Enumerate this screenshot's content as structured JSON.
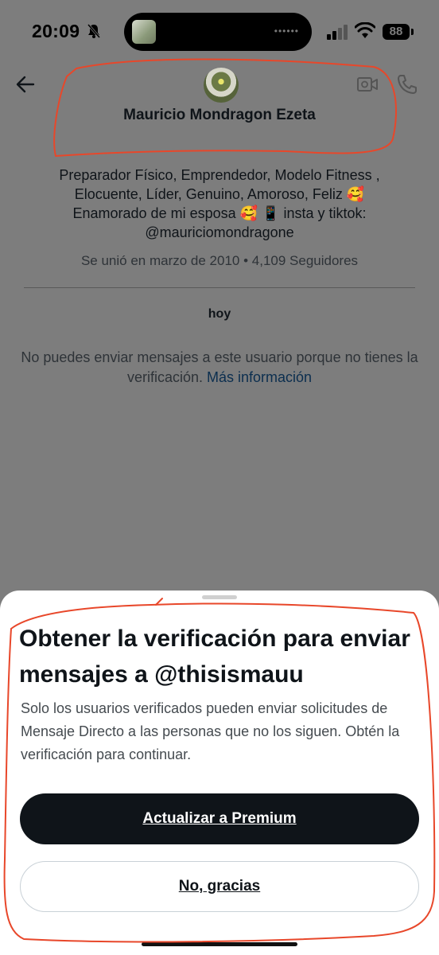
{
  "status_bar": {
    "time": "20:09",
    "battery": "88"
  },
  "header": {
    "name": "Mauricio Mondragon Ezeta",
    "icons": [
      "back-arrow-icon",
      "video-icon",
      "phone-icon"
    ]
  },
  "profile": {
    "bio_lines": [
      "Preparador Físico, Emprendedor, Modelo Fitness ,",
      "Elocuente, Líder, Genuino, Amoroso, Feliz 🥰",
      "Enamorado de mi esposa 🥰 📱 insta y tiktok:",
      "@mauriciomondragone"
    ],
    "meta": "Se unió en marzo de 2010 • 4,109 Seguidores"
  },
  "conversation": {
    "day_label": "hoy",
    "notice": "No puedes enviar mensajes a este usuario porque no tienes la verificación.",
    "notice_link": "Más información"
  },
  "sheet": {
    "title": "Obtener la verificación para enviar mensajes a @thisismauu",
    "body": "Solo los usuarios verificados pueden enviar solicitudes de Mensaje Directo a las personas que no los siguen. Obtén la verificación para continuar.",
    "primary_button": "Actualizar a Premium",
    "secondary_button": "No, gracias"
  },
  "colors": {
    "overlay": "#7d7d7d",
    "primary_button": "#0f1419",
    "annotation": "#e8472a"
  }
}
